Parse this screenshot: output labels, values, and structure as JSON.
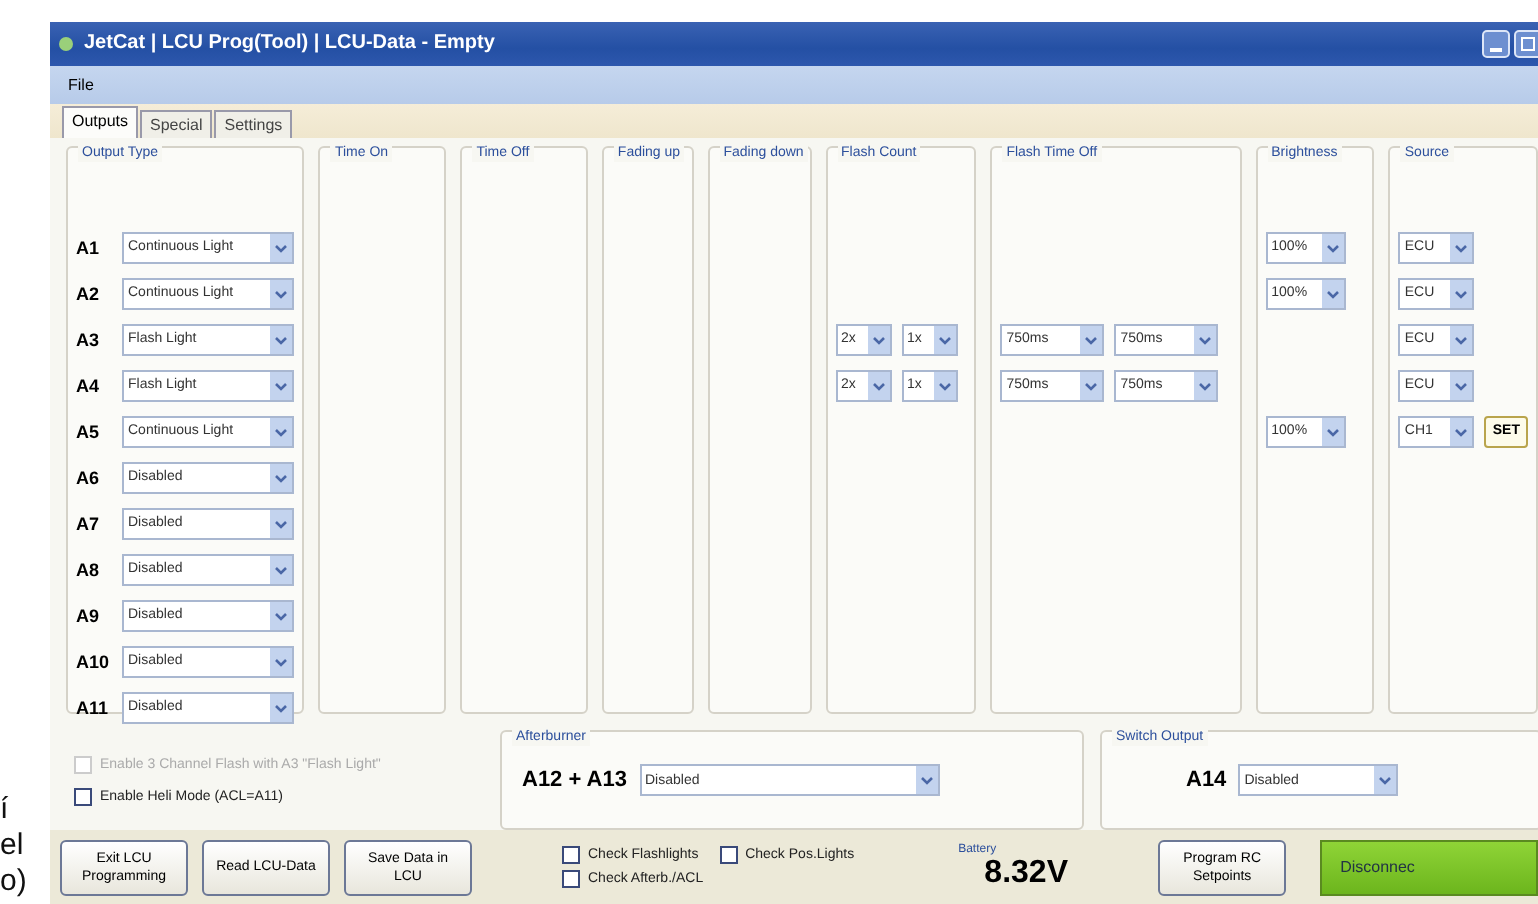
{
  "margin_fragments": [
    "í",
    "el",
    "o)"
  ],
  "window": {
    "title": "JetCat | LCU Prog(Tool) | LCU-Data - Empty"
  },
  "menu": [
    "File"
  ],
  "tabs": [
    {
      "label": "Outputs",
      "selected": true
    },
    {
      "label": "Special",
      "selected": false
    },
    {
      "label": "Settings",
      "selected": false
    }
  ],
  "groups": [
    {
      "kind": "output_type",
      "legend": "Output Type"
    },
    {
      "kind": "empty",
      "legend": "Time On"
    },
    {
      "kind": "empty",
      "legend": "Time Off"
    },
    {
      "kind": "empty",
      "legend": "Fading up"
    },
    {
      "kind": "empty",
      "legend": "Fading down"
    },
    {
      "kind": "flash_count",
      "legend": "Flash Count"
    },
    {
      "kind": "flash_time_off",
      "legend": "Flash Time Off"
    },
    {
      "kind": "brightness",
      "legend": "Brightness"
    },
    {
      "kind": "source",
      "legend": "Source"
    }
  ],
  "outputs": [
    {
      "label": "A1",
      "type": "Continuous Light",
      "brightness": "100%",
      "source": "ECU"
    },
    {
      "label": "A2",
      "type": "Continuous Light",
      "brightness": "100%",
      "source": "ECU"
    },
    {
      "label": "A3",
      "type": "Flash Light",
      "flash_count": [
        "2x",
        "1x"
      ],
      "flash_time_off": [
        "750ms",
        "750ms"
      ],
      "source": "ECU"
    },
    {
      "label": "A4",
      "type": "Flash Light",
      "flash_count": [
        "2x",
        "1x"
      ],
      "flash_time_off": [
        "750ms",
        "750ms"
      ],
      "source": "ECU"
    },
    {
      "label": "A5",
      "type": "Continuous Light",
      "brightness": "100%",
      "source": "CH1",
      "set_button": "SET"
    },
    {
      "label": "A6",
      "type": "Disabled"
    },
    {
      "label": "A7",
      "type": "Disabled"
    },
    {
      "label": "A8",
      "type": "Disabled"
    },
    {
      "label": "A9",
      "type": "Disabled"
    },
    {
      "label": "A10",
      "type": "Disabled"
    },
    {
      "label": "A11",
      "type": "Disabled"
    }
  ],
  "options": [
    {
      "label": "Enable 3 Channel Flash with A3 \"Flash Light\"",
      "checked": false,
      "disabled": true
    },
    {
      "label": "Enable Heli Mode (ACL=A11)",
      "checked": false,
      "disabled": false
    }
  ],
  "afterburner": {
    "legend": "Afterburner",
    "label": "A12 + A13",
    "value": "Disabled"
  },
  "switch_output": {
    "legend": "Switch Output",
    "label": "A14",
    "value": "Disabled"
  },
  "bottom_buttons": [
    "Exit LCU Programming",
    "Read LCU-Data",
    "Save Data in LCU"
  ],
  "checks": [
    {
      "label": "Check Flashlights",
      "checked": false
    },
    {
      "label": "Check Pos.Lights",
      "checked": false
    },
    {
      "label": "Check Afterb./ACL",
      "checked": false
    }
  ],
  "battery": {
    "legend": "Battery",
    "value": "8.32V"
  },
  "program_button": "Program RC Setpoints",
  "disconnect_button": "Disconnec"
}
